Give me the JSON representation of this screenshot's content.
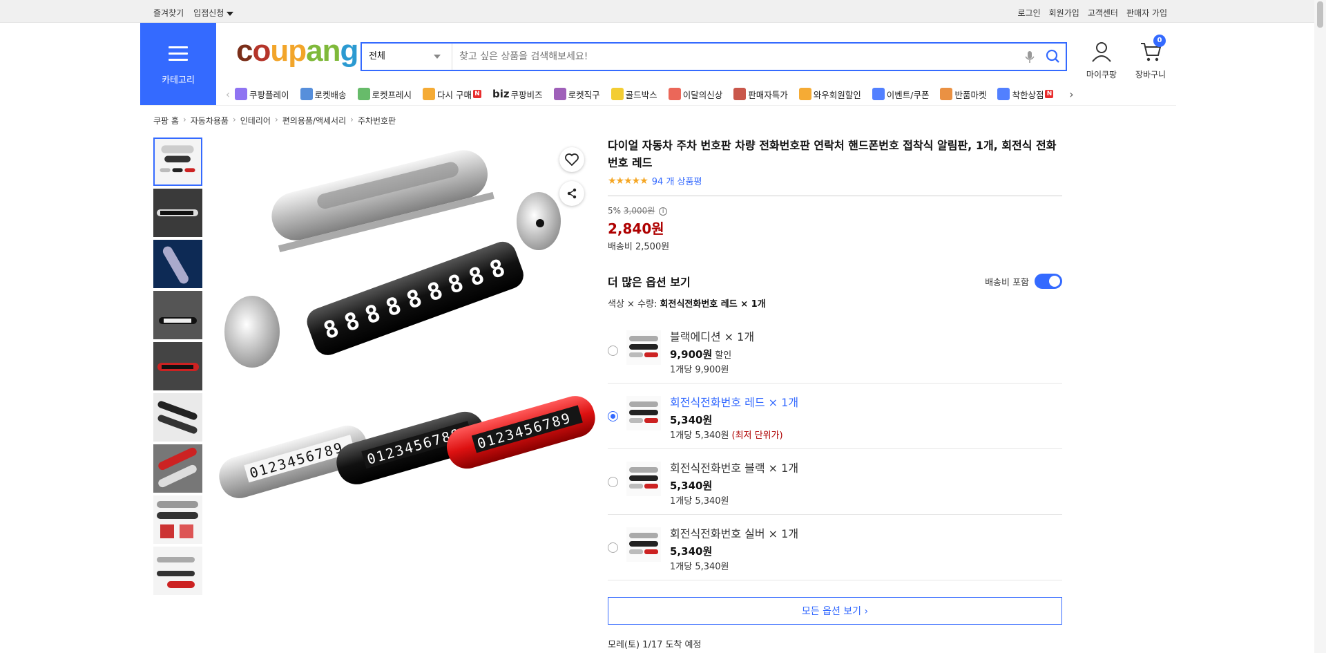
{
  "topbar": {
    "favorites": "즐겨찾기",
    "vendor_apply": "입점신청",
    "login": "로그인",
    "signup": "회원가입",
    "customer_center": "고객센터",
    "seller_signup": "판매자 가입"
  },
  "header": {
    "category_label": "카테고리",
    "logo": {
      "c": "c",
      "o": "o",
      "u": "u",
      "p": "p",
      "a": "a",
      "n": "n",
      "g": "g"
    },
    "search_category": "전체",
    "search_placeholder": "찾고 싶은 상품을 검색해보세요!",
    "mycoupang": "마이쿠팡",
    "cart": "장바구니",
    "cart_count": "0"
  },
  "nav": {
    "items": [
      {
        "label": "쿠팡플레이",
        "icon": "coupang-play-icon",
        "color": "#7b5cf0"
      },
      {
        "label": "로켓배송",
        "icon": "rocket-icon",
        "color": "#3a7bd5"
      },
      {
        "label": "로켓프레시",
        "icon": "rocket-fresh-icon",
        "color": "#4caf50"
      },
      {
        "label": "다시 구매",
        "icon": "rebuy-icon",
        "color": "#f39c12",
        "badge": "N"
      },
      {
        "label": "쿠팡비즈",
        "icon": "biz-icon",
        "prefix": "biz",
        "color": "#222"
      },
      {
        "label": "로켓직구",
        "icon": "rocket-direct-icon",
        "color": "#8e44ad"
      },
      {
        "label": "골드박스",
        "icon": "goldbox-icon",
        "color": "#f1c40f"
      },
      {
        "label": "이달의신상",
        "icon": "new-icon",
        "color": "#e74c3c"
      },
      {
        "label": "판매자특가",
        "icon": "seller-deal-icon",
        "color": "#c0392b"
      },
      {
        "label": "와우회원할인",
        "icon": "wow-icon",
        "color": "#f39c12"
      },
      {
        "label": "이벤트/쿠폰",
        "icon": "coupon-icon",
        "color": "#346aff"
      },
      {
        "label": "반품마켓",
        "icon": "return-market-icon",
        "color": "#e67e22"
      },
      {
        "label": "착한상점",
        "icon": "good-store-icon",
        "color": "#346aff",
        "badge": "N"
      }
    ]
  },
  "breadcrumb": [
    "쿠팡 홈",
    "자동차용품",
    "인테리어",
    "편의용품/액세서리",
    "주차번호판"
  ],
  "product": {
    "title": "다이얼 자동차 주차 번호판 차량 전화번호판 연락처 핸드폰번호 접착식 알림판, 1개, 회전식 전화번호 레드",
    "stars": "★★★★★",
    "review_count": "94 개 상품평",
    "discount_rate": "5%",
    "original_price": "3,000원",
    "price": "2,840원",
    "shipping": "배송비 2,500원"
  },
  "options": {
    "heading": "더 많은 옵션 보기",
    "shipping_include_label": "배송비 포함",
    "selected_label": "색상 × 수량:",
    "selected_value": "회전식전화번호 레드 × 1개",
    "list": [
      {
        "name": "블랙에디션 × 1개",
        "price": "9,900원",
        "tag": "할인",
        "unit": "1개당 9,900원",
        "note": "",
        "selected": false
      },
      {
        "name": "회전식전화번호 레드 × 1개",
        "price": "5,340원",
        "tag": "",
        "unit": "1개당 5,340원",
        "note": "(최저 단위가)",
        "selected": true
      },
      {
        "name": "회전식전화번호 블랙 × 1개",
        "price": "5,340원",
        "tag": "",
        "unit": "1개당 5,340원",
        "note": "",
        "selected": false
      },
      {
        "name": "회전식전화번호 실버 × 1개",
        "price": "5,340원",
        "tag": "",
        "unit": "1개당 5,340원",
        "note": "",
        "selected": false
      }
    ],
    "all_options": "모든 옵션 보기 ›"
  },
  "delivery": {
    "day": "모레(토)",
    "date": "1/17 도착 예정"
  },
  "colors": {
    "accent": "#346aff",
    "price_red": "#ae0000"
  }
}
